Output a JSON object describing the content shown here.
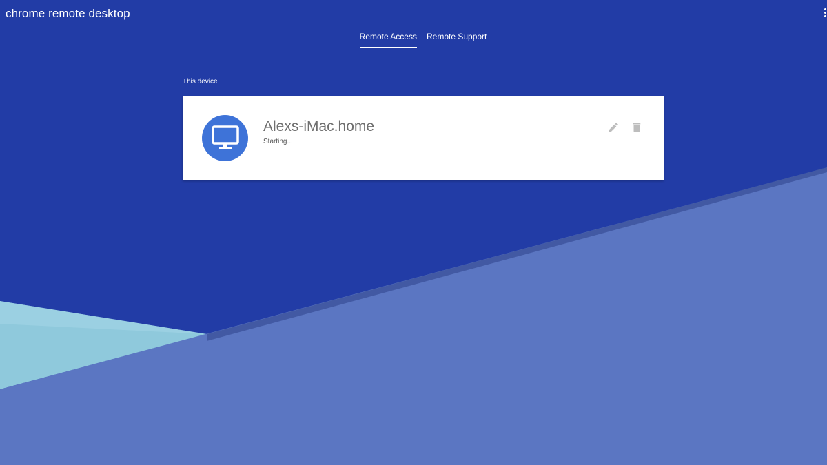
{
  "app": {
    "title": "chrome remote desktop"
  },
  "tabs": [
    {
      "label": "Remote Access",
      "active": true
    },
    {
      "label": "Remote Support",
      "active": false
    }
  ],
  "section": {
    "label": "This device"
  },
  "device": {
    "name": "Alexs-iMac.home",
    "status": "Starting...",
    "icon": "computer-monitor-icon"
  },
  "actions": {
    "edit_icon": "pencil-icon",
    "delete_icon": "trash-icon"
  },
  "colors": {
    "background": "#223ca6",
    "accent": "#3e73d8",
    "light_shape": "#8fc9dc",
    "mid_shape": "#5b76c2"
  }
}
